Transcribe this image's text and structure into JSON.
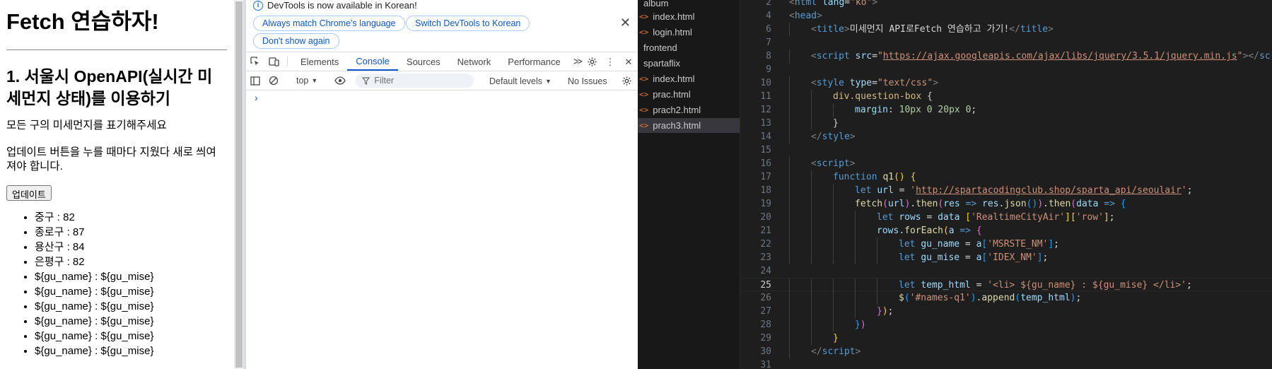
{
  "page": {
    "title": "Fetch 연습하자!",
    "heading": "1. 서울시 OpenAPI(실시간 미세먼지 상태)를 이용하기",
    "desc1": "모든 구의 미세먼지를 표기해주세요",
    "desc2": "업데이트 버튼을 누를 때마다 지웠다 새로 씌여져야 합니다.",
    "button_label": "업데이트",
    "items": [
      "중구 : 82",
      "종로구 : 87",
      "용산구 : 84",
      "은평구 : 82",
      "${gu_name} : ${gu_mise}",
      "${gu_name} : ${gu_mise}",
      "${gu_name} : ${gu_mise}",
      "${gu_name} : ${gu_mise}",
      "${gu_name} : ${gu_mise}",
      "${gu_name} : ${gu_mise}"
    ]
  },
  "devtools": {
    "info_message": "DevTools is now available in Korean!",
    "buttons": {
      "match_language": "Always match Chrome's language",
      "switch_korean": "Switch DevTools to Korean",
      "dont_show": "Don't show again"
    },
    "tabs": [
      "Elements",
      "Console",
      "Sources",
      "Network",
      "Performance"
    ],
    "active_tab": "Console",
    "context": "top",
    "filter_placeholder": "Filter",
    "levels": "Default levels",
    "issues": "No Issues",
    "accent": "#0b57d0"
  },
  "explorer": {
    "items": [
      {
        "label": "album",
        "type": "folder"
      },
      {
        "label": "index.html",
        "type": "file"
      },
      {
        "label": "login.html",
        "type": "file"
      },
      {
        "label": "frontend",
        "type": "folder"
      },
      {
        "label": "spartaflix",
        "type": "folder"
      },
      {
        "label": "index.html",
        "type": "file"
      },
      {
        "label": "prac.html",
        "type": "file"
      },
      {
        "label": "prach2.html",
        "type": "file"
      },
      {
        "label": "prach3.html",
        "type": "file",
        "selected": true
      }
    ]
  },
  "editor": {
    "current_line": 25,
    "lines": [
      {
        "n": "2",
        "indent": 0,
        "t": [
          [
            "br",
            "<"
          ],
          [
            "tag",
            "html"
          ],
          [
            "txt",
            " "
          ],
          [
            "attr",
            "lang"
          ],
          [
            "txt",
            "="
          ],
          [
            "str",
            "\"ko\""
          ],
          [
            "br",
            ">"
          ]
        ]
      },
      {
        "n": "4",
        "indent": 0,
        "t": [
          [
            "br",
            "<"
          ],
          [
            "tag",
            "head"
          ],
          [
            "br",
            ">"
          ]
        ]
      },
      {
        "n": "6",
        "indent": 1,
        "t": [
          [
            "br",
            "<"
          ],
          [
            "tag",
            "title"
          ],
          [
            "br",
            ">"
          ],
          [
            "txt",
            "미세먼지 API로Fetch 연습하고 가기!"
          ],
          [
            "br",
            "</"
          ],
          [
            "tag",
            "title"
          ],
          [
            "br",
            ">"
          ]
        ]
      },
      {
        "n": "7",
        "indent": 0,
        "t": []
      },
      {
        "n": "8",
        "indent": 1,
        "t": [
          [
            "br",
            "<"
          ],
          [
            "tag",
            "script"
          ],
          [
            "txt",
            " "
          ],
          [
            "attr",
            "src"
          ],
          [
            "txt",
            "="
          ],
          [
            "str",
            "\""
          ],
          [
            "url",
            "https://ajax.googleapis.com/ajax/libs/jquery/3.5.1/jquery.min.js"
          ],
          [
            "str",
            "\""
          ],
          [
            "br",
            "></"
          ],
          [
            "tag",
            "script"
          ],
          [
            "br",
            ">"
          ]
        ]
      },
      {
        "n": "9",
        "indent": 0,
        "t": []
      },
      {
        "n": "10",
        "indent": 1,
        "t": [
          [
            "br",
            "<"
          ],
          [
            "tag",
            "style"
          ],
          [
            "txt",
            " "
          ],
          [
            "attr",
            "type"
          ],
          [
            "txt",
            "="
          ],
          [
            "str",
            "\"text/css\""
          ],
          [
            "br",
            ">"
          ]
        ]
      },
      {
        "n": "11",
        "indent": 2,
        "t": [
          [
            "sel",
            "div.question-box"
          ],
          [
            "txt",
            " {"
          ]
        ]
      },
      {
        "n": "12",
        "indent": 3,
        "t": [
          [
            "prop",
            "margin"
          ],
          [
            "txt",
            ": "
          ],
          [
            "num",
            "10px"
          ],
          [
            "txt",
            " "
          ],
          [
            "num",
            "0"
          ],
          [
            "txt",
            " "
          ],
          [
            "num",
            "20px"
          ],
          [
            "txt",
            " "
          ],
          [
            "num",
            "0"
          ],
          [
            "txt",
            ";"
          ]
        ]
      },
      {
        "n": "13",
        "indent": 2,
        "t": [
          [
            "txt",
            "}"
          ]
        ]
      },
      {
        "n": "14",
        "indent": 1,
        "t": [
          [
            "br",
            "</"
          ],
          [
            "tag",
            "style"
          ],
          [
            "br",
            ">"
          ]
        ]
      },
      {
        "n": "15",
        "indent": 0,
        "t": []
      },
      {
        "n": "16",
        "indent": 1,
        "t": [
          [
            "br",
            "<"
          ],
          [
            "tag",
            "script"
          ],
          [
            "br",
            ">"
          ]
        ]
      },
      {
        "n": "17",
        "indent": 2,
        "t": [
          [
            "kw",
            "function"
          ],
          [
            "txt",
            " "
          ],
          [
            "fn",
            "q1"
          ],
          [
            "p1",
            "()"
          ],
          [
            "txt",
            " "
          ],
          [
            "p1",
            "{"
          ]
        ]
      },
      {
        "n": "18",
        "indent": 3,
        "t": [
          [
            "kw",
            "let"
          ],
          [
            "txt",
            " "
          ],
          [
            "var",
            "url"
          ],
          [
            "txt",
            " = "
          ],
          [
            "str",
            "'"
          ],
          [
            "url",
            "http://spartacodingclub.shop/sparta_api/seoulair"
          ],
          [
            "str",
            "'"
          ],
          [
            "txt",
            ";"
          ]
        ]
      },
      {
        "n": "19",
        "indent": 3,
        "t": [
          [
            "fn",
            "fetch"
          ],
          [
            "p2",
            "("
          ],
          [
            "var",
            "url"
          ],
          [
            "p2",
            ")"
          ],
          [
            "txt",
            "."
          ],
          [
            "fn",
            "then"
          ],
          [
            "p2",
            "("
          ],
          [
            "var",
            "res"
          ],
          [
            "txt",
            " "
          ],
          [
            "kw",
            "=>"
          ],
          [
            "txt",
            " "
          ],
          [
            "var",
            "res"
          ],
          [
            "txt",
            "."
          ],
          [
            "fn",
            "json"
          ],
          [
            "p3",
            "()"
          ],
          [
            "p2",
            ")"
          ],
          [
            "txt",
            "."
          ],
          [
            "fn",
            "then"
          ],
          [
            "p2",
            "("
          ],
          [
            "var",
            "data"
          ],
          [
            "txt",
            " "
          ],
          [
            "kw",
            "=>"
          ],
          [
            "txt",
            " "
          ],
          [
            "p3",
            "{"
          ]
        ]
      },
      {
        "n": "20",
        "indent": 4,
        "t": [
          [
            "kw",
            "let"
          ],
          [
            "txt",
            " "
          ],
          [
            "var",
            "rows"
          ],
          [
            "txt",
            " = "
          ],
          [
            "var",
            "data"
          ],
          [
            "txt",
            " "
          ],
          [
            "p1",
            "["
          ],
          [
            "str",
            "'RealtimeCityAir'"
          ],
          [
            "p1",
            "]"
          ],
          [
            "p1",
            "["
          ],
          [
            "str",
            "'row'"
          ],
          [
            "p1",
            "]"
          ],
          [
            "txt",
            ";"
          ]
        ]
      },
      {
        "n": "21",
        "indent": 4,
        "t": [
          [
            "var",
            "rows"
          ],
          [
            "txt",
            "."
          ],
          [
            "fn",
            "forEach"
          ],
          [
            "p1",
            "("
          ],
          [
            "var",
            "a"
          ],
          [
            "txt",
            " "
          ],
          [
            "kw",
            "=>"
          ],
          [
            "txt",
            " "
          ],
          [
            "p2",
            "{"
          ]
        ]
      },
      {
        "n": "22",
        "indent": 5,
        "t": [
          [
            "kw",
            "let"
          ],
          [
            "txt",
            " "
          ],
          [
            "var",
            "gu_name"
          ],
          [
            "txt",
            " = "
          ],
          [
            "var",
            "a"
          ],
          [
            "p3",
            "["
          ],
          [
            "str",
            "'MSRSTE_NM'"
          ],
          [
            "p3",
            "]"
          ],
          [
            "txt",
            ";"
          ]
        ]
      },
      {
        "n": "23",
        "indent": 5,
        "t": [
          [
            "kw",
            "let"
          ],
          [
            "txt",
            " "
          ],
          [
            "var",
            "gu_mise"
          ],
          [
            "txt",
            " = "
          ],
          [
            "var",
            "a"
          ],
          [
            "p3",
            "["
          ],
          [
            "str",
            "'IDEX_NM'"
          ],
          [
            "p3",
            "]"
          ],
          [
            "txt",
            ";"
          ]
        ]
      },
      {
        "n": "24",
        "indent": 0,
        "t": []
      },
      {
        "n": "25",
        "indent": 5,
        "t": [
          [
            "kw",
            "let"
          ],
          [
            "txt",
            " "
          ],
          [
            "var",
            "temp_html"
          ],
          [
            "txt",
            " = "
          ],
          [
            "str",
            "'<li> ${gu_name} : ${gu_mise} </li>'"
          ],
          [
            "txt",
            ";"
          ]
        ]
      },
      {
        "n": "26",
        "indent": 5,
        "t": [
          [
            "fn",
            "$"
          ],
          [
            "p3",
            "("
          ],
          [
            "str",
            "'#names-q1'"
          ],
          [
            "p3",
            ")"
          ],
          [
            "txt",
            "."
          ],
          [
            "fn",
            "append"
          ],
          [
            "p3",
            "("
          ],
          [
            "var",
            "temp_html"
          ],
          [
            "p3",
            ")"
          ],
          [
            "txt",
            ";"
          ]
        ]
      },
      {
        "n": "27",
        "indent": 4,
        "t": [
          [
            "p2",
            "}"
          ],
          [
            "p1",
            ")"
          ],
          [
            "txt",
            ";"
          ]
        ]
      },
      {
        "n": "28",
        "indent": 3,
        "t": [
          [
            "p3",
            "}"
          ],
          [
            "p2",
            ")"
          ]
        ]
      },
      {
        "n": "29",
        "indent": 2,
        "t": [
          [
            "p1",
            "}"
          ]
        ]
      },
      {
        "n": "30",
        "indent": 1,
        "t": [
          [
            "br",
            "</"
          ],
          [
            "tag",
            "script"
          ],
          [
            "br",
            ">"
          ]
        ]
      },
      {
        "n": "31",
        "indent": 0,
        "t": []
      }
    ]
  }
}
